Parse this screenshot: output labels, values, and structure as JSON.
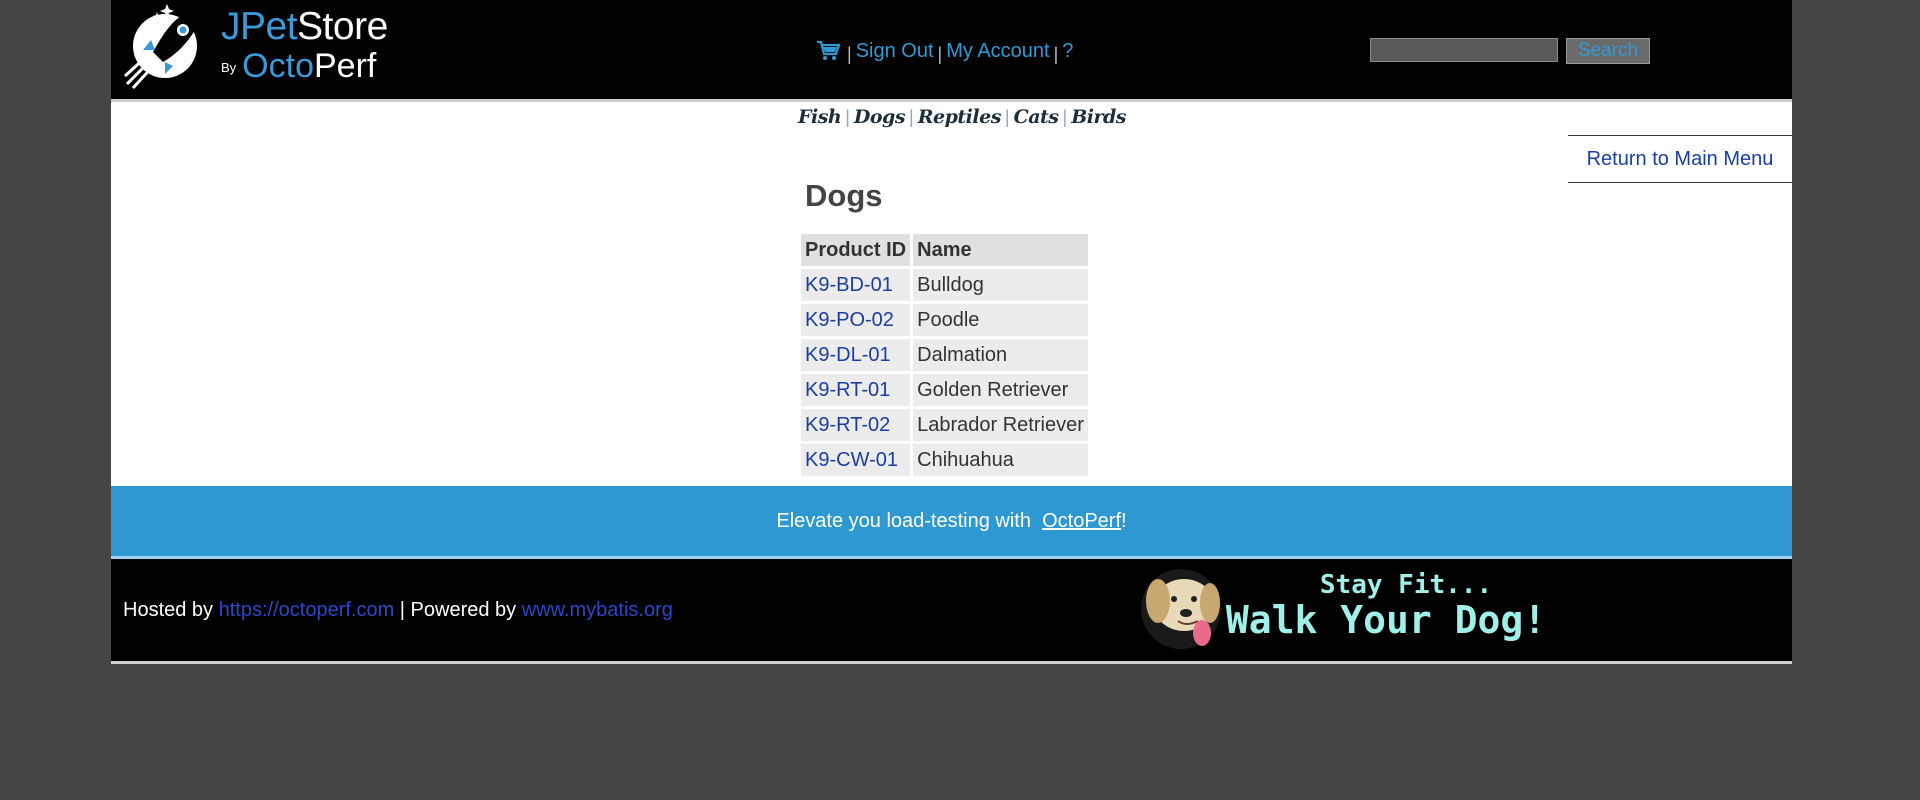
{
  "header": {
    "logo": {
      "word_part1": "JPet",
      "word_part2": "Store",
      "by": "By",
      "octo": "Octo",
      "perf": "Perf"
    },
    "menu": {
      "sign_out": "Sign Out",
      "my_account": "My Account",
      "help": "?",
      "separator": "|"
    },
    "search": {
      "button_label": "Search",
      "input_value": ""
    }
  },
  "quicklinks": [
    "Fish",
    "Dogs",
    "Reptiles",
    "Cats",
    "Birds"
  ],
  "back_link": "Return to Main Menu",
  "catalog": {
    "title": "Dogs",
    "columns": [
      "Product ID",
      "Name"
    ],
    "rows": [
      {
        "id": "K9-BD-01",
        "name": "Bulldog"
      },
      {
        "id": "K9-PO-02",
        "name": "Poodle"
      },
      {
        "id": "K9-DL-01",
        "name": "Dalmation"
      },
      {
        "id": "K9-RT-01",
        "name": "Golden Retriever"
      },
      {
        "id": "K9-RT-02",
        "name": "Labrador Retriever"
      },
      {
        "id": "K9-CW-01",
        "name": "Chihuahua"
      }
    ]
  },
  "promo": {
    "text_before": "Elevate you load-testing with ",
    "link": "OctoPerf",
    "text_after": "!"
  },
  "footer": {
    "hosted_by": "Hosted by ",
    "hosted_link": "https://octoperf.com",
    "powered_by": " | Powered by ",
    "powered_link": "www.mybatis.org",
    "banner_line1": "Stay Fit...",
    "banner_line2": "Walk Your Dog!"
  },
  "colors": {
    "accent_blue": "#2e98d3",
    "link_blue": "#1a3ea6",
    "header_bg": "#000000",
    "page_bg": "#454545"
  }
}
